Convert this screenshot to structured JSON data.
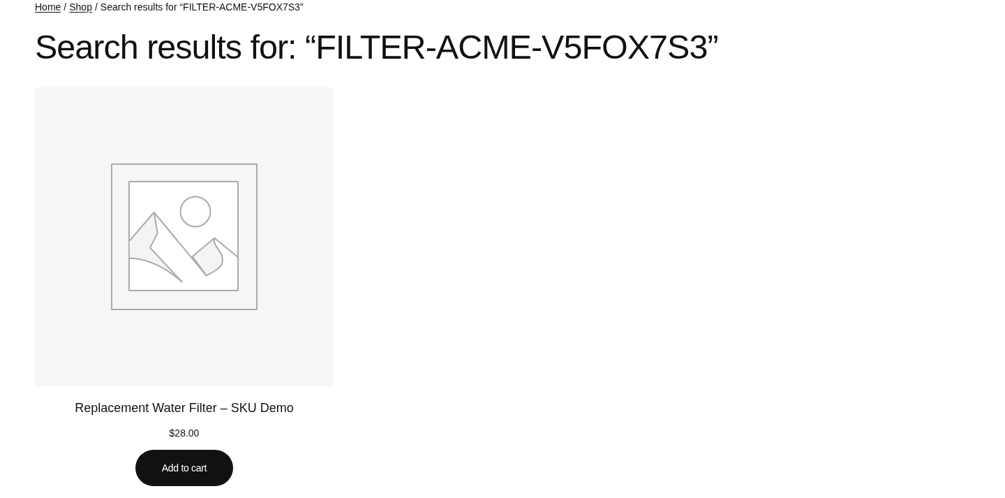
{
  "breadcrumb": [
    {
      "kind": "link",
      "text": "Home"
    },
    {
      "kind": "separator",
      "text": "/"
    },
    {
      "kind": "link",
      "text": "Shop"
    },
    {
      "kind": "separator",
      "text": "/"
    },
    {
      "kind": "current",
      "text": "Search results for “FILTER-ACME-V5FOX7S3”"
    }
  ],
  "heading": "Search results for: “FILTER-ACME-V5FOX7S3”",
  "products": [
    {
      "title": "Replacement Water Filter – SKU Demo",
      "price": "$28.00",
      "button": "Add to cart"
    }
  ]
}
